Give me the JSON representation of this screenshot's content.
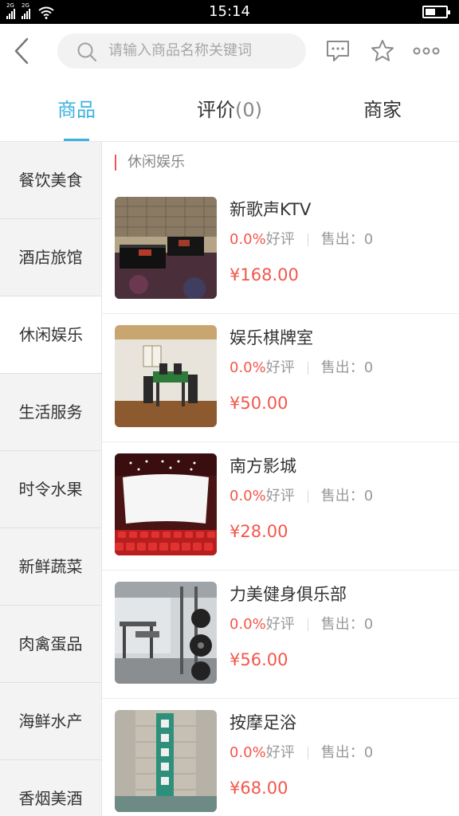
{
  "status_bar": {
    "net1": "2G",
    "net2": "2G",
    "time": "15:14"
  },
  "header": {
    "search_placeholder": "请输入商品名称关键词",
    "icons": [
      "back-icon",
      "search-icon",
      "chat-icon",
      "star-icon",
      "more-icon"
    ]
  },
  "tabs": [
    {
      "label": "商品",
      "active": true
    },
    {
      "label": "评价",
      "count": "(0)"
    },
    {
      "label": "商家"
    }
  ],
  "sidebar": {
    "items": [
      {
        "label": "餐饮美食"
      },
      {
        "label": "酒店旅馆"
      },
      {
        "label": "休闲娱乐",
        "active": true
      },
      {
        "label": "生活服务"
      },
      {
        "label": "时令水果"
      },
      {
        "label": "新鲜蔬菜"
      },
      {
        "label": "肉禽蛋品"
      },
      {
        "label": "海鲜水产"
      },
      {
        "label": "香烟美酒"
      }
    ]
  },
  "section": {
    "title": "休闲娱乐"
  },
  "products": [
    {
      "name": "新歌声KTV",
      "rating_pct": "0.0%",
      "rating_label": "好评",
      "sold": "售出：0",
      "price": "¥168.00"
    },
    {
      "name": "娱乐棋牌室",
      "rating_pct": "0.0%",
      "rating_label": "好评",
      "sold": "售出：0",
      "price": "¥50.00"
    },
    {
      "name": "南方影城",
      "rating_pct": "0.0%",
      "rating_label": "好评",
      "sold": "售出：0",
      "price": "¥28.00"
    },
    {
      "name": "力美健身俱乐部",
      "rating_pct": "0.0%",
      "rating_label": "好评",
      "sold": "售出：0",
      "price": "¥56.00"
    },
    {
      "name": "按摩足浴",
      "rating_pct": "0.0%",
      "rating_label": "好评",
      "sold": "售出：0",
      "price": "¥68.00"
    }
  ],
  "colors": {
    "accent": "#3ab2e0",
    "price": "#f2574c",
    "sidebar_bg": "#f3f3f3"
  }
}
